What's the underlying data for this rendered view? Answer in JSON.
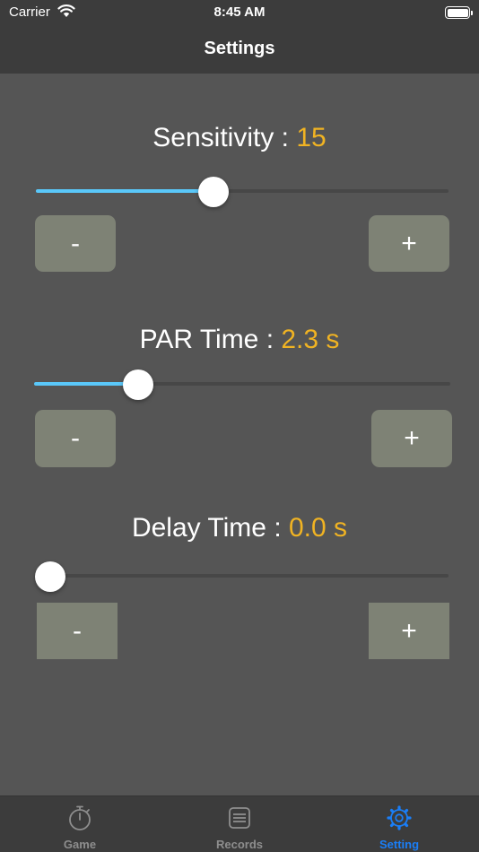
{
  "status_bar": {
    "carrier": "Carrier",
    "time": "8:45 AM"
  },
  "nav": {
    "title": "Settings"
  },
  "settings": [
    {
      "label": "Sensitivity : ",
      "value": "15",
      "level": 0.43
    },
    {
      "label": "PAR Time :  ",
      "value": "2.3 s",
      "level": 0.25
    },
    {
      "label": "Delay Time :  ",
      "value": "0.0 s",
      "level": 0.0
    }
  ],
  "buttons": {
    "decrement": "-",
    "increment": "+"
  },
  "tabs": [
    {
      "label": "Game",
      "icon": "stopwatch-icon",
      "active": false
    },
    {
      "label": "Records",
      "icon": "records-icon",
      "active": false
    },
    {
      "label": "Setting",
      "icon": "gear-icon",
      "active": true
    }
  ],
  "colors": {
    "accent_value": "#f0b323",
    "slider_fill": "#5ac8fa",
    "tab_active": "#1a7ef7",
    "button": "#7e8275"
  }
}
